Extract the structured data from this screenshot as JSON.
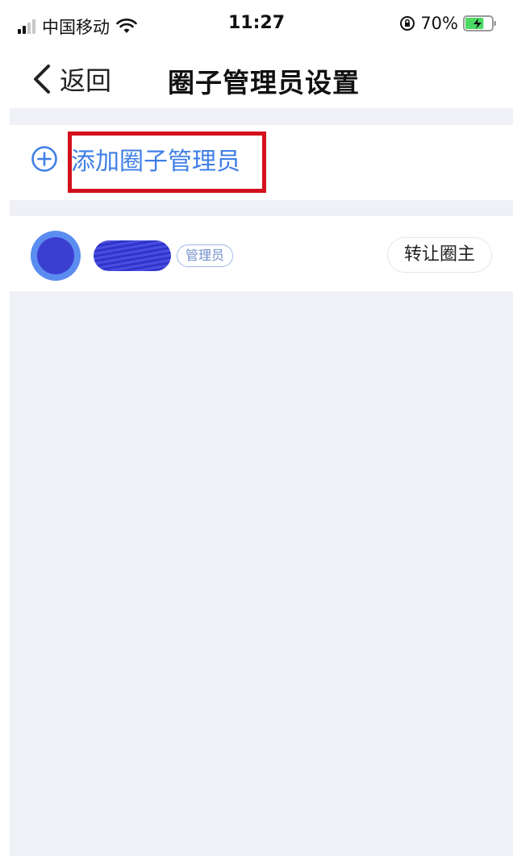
{
  "status_bar": {
    "carrier": "中国移动",
    "time": "11:27",
    "battery_percent": "70%",
    "battery_level": 0.7
  },
  "nav": {
    "back_label": "返回",
    "title": "圈子管理员设置"
  },
  "add_admin": {
    "label": "添加圈子管理员"
  },
  "members": [
    {
      "role_badge": "管理员",
      "action_label": "转让圈主"
    }
  ],
  "colors": {
    "accent_blue": "#3f7fe6",
    "highlight_red": "#d3101c",
    "background_gray": "#f0f1f6"
  }
}
